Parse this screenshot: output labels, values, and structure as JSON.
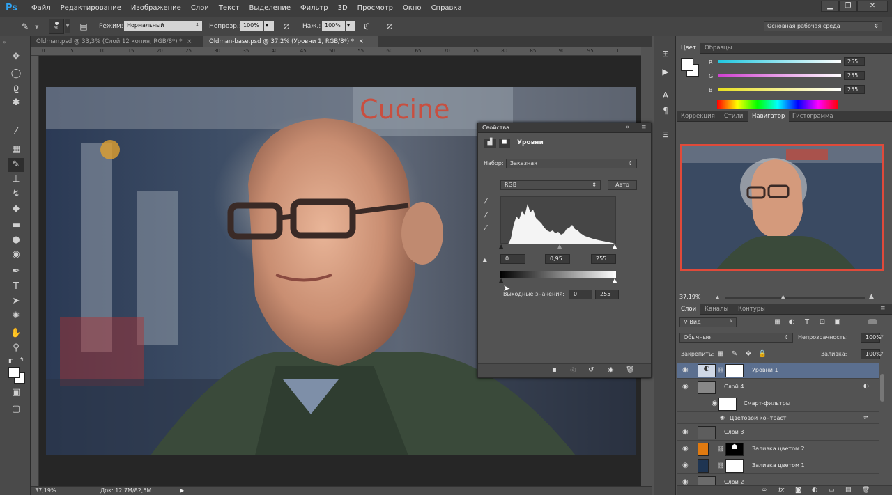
{
  "app": {
    "logo": "Ps"
  },
  "menu": [
    "Файл",
    "Редактирование",
    "Изображение",
    "Слои",
    "Текст",
    "Выделение",
    "Фильтр",
    "3D",
    "Просмотр",
    "Окно",
    "Справка"
  ],
  "window_buttons": {
    "minimize": "▁",
    "restore": "❐",
    "close": "✕"
  },
  "options": {
    "brush_size": "60",
    "mode_label": "Режим:",
    "mode_value": "Нормальный",
    "opacity_label": "Непрозр.:",
    "opacity_value": "100%",
    "pressure_label": "Наж.:",
    "pressure_value": "100%",
    "workspace": "Основная рабочая среда"
  },
  "doc_tabs": [
    {
      "label": "Oldman.psd @ 33,3% (Слой 12 копия, RGB/8*) *",
      "close": "×"
    },
    {
      "label": "Oldman-base.psd @ 37,2% (Уровни 1, RGB/8*) *",
      "close": "×"
    }
  ],
  "ruler_top": [
    "0",
    "5",
    "10",
    "15",
    "20",
    "25",
    "30",
    "35",
    "40",
    "45",
    "50",
    "55",
    "60",
    "65",
    "70",
    "75",
    "80",
    "85",
    "90",
    "95",
    "1"
  ],
  "photo": {
    "sign_text": "Cucine"
  },
  "status": {
    "zoom": "37,19%",
    "doc_info": "Док: 12,7M/82,5M"
  },
  "properties": {
    "title": "Свойства",
    "adjustment": "Уровни",
    "preset_label": "Набор:",
    "preset_value": "Заказная",
    "channel": "RGB",
    "auto_button": "Авто",
    "input_black": "0",
    "input_gamma": "0,95",
    "input_white": "255",
    "output_label": "Выходные значения:",
    "output_black": "0",
    "output_white": "255"
  },
  "color_panel": {
    "tabs": [
      "Цвет",
      "Образцы"
    ],
    "channels": [
      {
        "label": "R",
        "value": "255",
        "color": "#20c8e0"
      },
      {
        "label": "G",
        "value": "255",
        "color": "#d040d0"
      },
      {
        "label": "B",
        "value": "255",
        "color": "#e8e020"
      }
    ]
  },
  "nav_panel": {
    "tabs": [
      "Коррекция",
      "Стили",
      "Навигатор",
      "Гистограмма"
    ],
    "zoom": "37,19%"
  },
  "layers_panel": {
    "tabs": [
      "Слои",
      "Каналы",
      "Контуры"
    ],
    "filter_kind": "Вид",
    "blend_mode": "Обычные",
    "opacity_label": "Непрозрачность:",
    "opacity_value": "100%",
    "lock_label": "Закрепить:",
    "fill_label": "Заливка:",
    "fill_value": "100%",
    "layers": [
      {
        "name": "Уровни 1"
      },
      {
        "name": "Слой 4"
      },
      {
        "name": "Смарт-фильтры"
      },
      {
        "name": "Цветовой контраст"
      },
      {
        "name": "Слой 3"
      },
      {
        "name": "Заливка цветом 2"
      },
      {
        "name": "Заливка цветом 1"
      },
      {
        "name": "Слой 2"
      }
    ],
    "footer_icons": [
      "∞",
      "fx",
      "◙",
      "◐",
      "▭",
      "▤",
      "🗑"
    ]
  }
}
